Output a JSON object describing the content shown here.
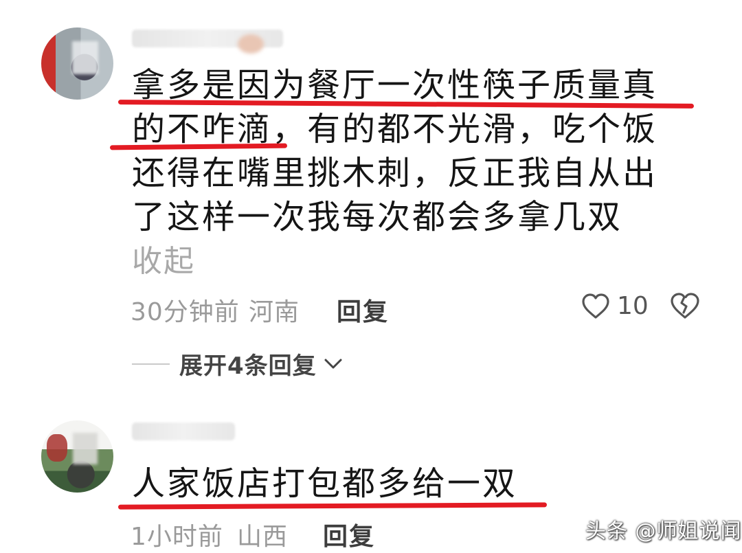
{
  "comments": [
    {
      "text_lines": [
        "拿多是因为餐厅一次性筷子质量真",
        "的不咋滴，有的都不光滑，吃个饭",
        "还得在嘴里挑木刺，反正我自从出",
        "了这样一次我每次都会多拿几双"
      ],
      "collapse_label": "收起",
      "time": "30分钟前",
      "location": "河南",
      "reply_label": "回复",
      "like_count": "10",
      "expand_label": "展开4条回复"
    },
    {
      "text": "人家饭店打包都多给一双",
      "time": "1小时前",
      "location": "山西",
      "reply_label": "回复"
    }
  ],
  "watermark": "头条 @师姐说闻",
  "colors": {
    "highlight": "#e31b23",
    "meta": "#9a9a9a"
  },
  "icons": [
    "heart-outline-icon",
    "broken-heart-icon",
    "chevron-down-icon"
  ]
}
